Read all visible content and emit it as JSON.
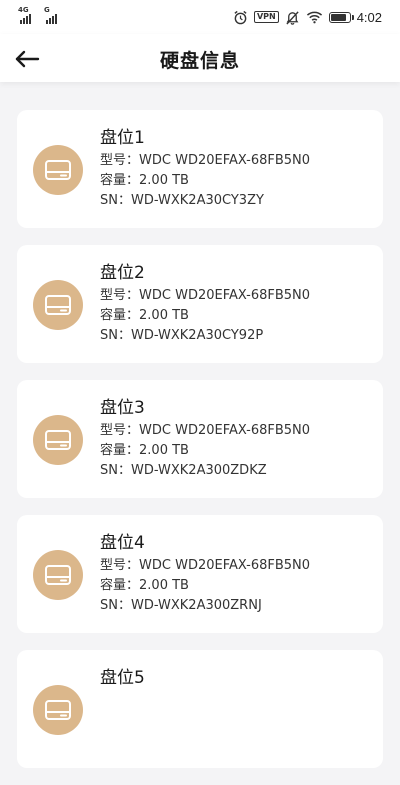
{
  "status_bar": {
    "network_1": "4G",
    "network_2": "G",
    "vpn": "VPN",
    "battery_level": 0.85,
    "time": "4:02"
  },
  "header": {
    "title": "硬盘信息"
  },
  "labels": {
    "model": "型号：",
    "capacity": "容量：",
    "sn": "SN："
  },
  "disks": [
    {
      "name": "盘位1",
      "model": "WDC WD20EFAX-68FB5N0",
      "capacity": "2.00 TB",
      "sn": "WD-WXK2A30CY3ZY"
    },
    {
      "name": "盘位2",
      "model": "WDC WD20EFAX-68FB5N0",
      "capacity": "2.00 TB",
      "sn": "WD-WXK2A30CY92P"
    },
    {
      "name": "盘位3",
      "model": "WDC WD20EFAX-68FB5N0",
      "capacity": "2.00 TB",
      "sn": "WD-WXK2A300ZDKZ"
    },
    {
      "name": "盘位4",
      "model": "WDC WD20EFAX-68FB5N0",
      "capacity": "2.00 TB",
      "sn": "WD-WXK2A300ZRNJ"
    },
    {
      "name": "盘位5",
      "model": "",
      "capacity": "",
      "sn": ""
    }
  ],
  "colors": {
    "accent": "#dbb78b",
    "background": "#f4f4f6",
    "card": "#ffffff"
  }
}
